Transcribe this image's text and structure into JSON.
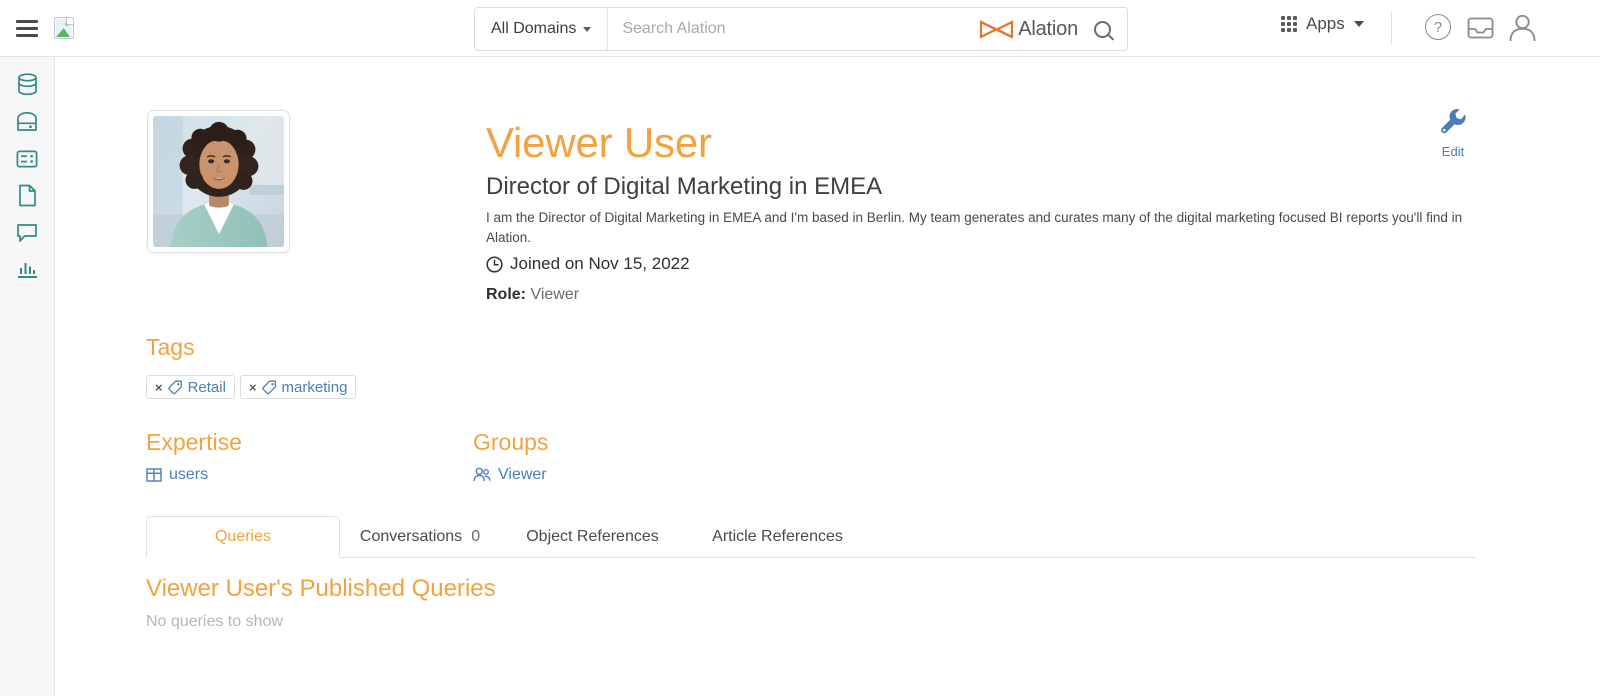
{
  "topbar": {
    "menu_icon": "hamburger-menu-icon",
    "logo_icon": "broken-image-icon",
    "domain_selector": "All Domains",
    "search_placeholder": "Search Alation",
    "brand_name": "Alation",
    "search_icon": "search-icon",
    "apps_label": "Apps",
    "apps_icon": "grid-apps-icon",
    "help_icon_char": "?",
    "help_icon": "help-circle-icon",
    "inbox_icon": "inbox-tray-icon",
    "account_icon": "user-account-icon"
  },
  "sidebar": {
    "items": [
      {
        "name": "sidebar-item-data-sources",
        "icon": "database-icon"
      },
      {
        "name": "sidebar-item-catalog",
        "icon": "vault-icon"
      },
      {
        "name": "sidebar-item-queries",
        "icon": "card-list-icon"
      },
      {
        "name": "sidebar-item-documents",
        "icon": "document-icon"
      },
      {
        "name": "sidebar-item-conversations",
        "icon": "chat-bubble-icon"
      },
      {
        "name": "sidebar-item-analytics",
        "icon": "bar-chart-icon"
      }
    ]
  },
  "profile": {
    "avatar_alt": "profile-photo-of-woman-in-teal-blazer",
    "name": "Viewer User",
    "title": "Director of Digital Marketing in EMEA",
    "bio": "I am the Director of Digital Marketing in EMEA and I'm based in Berlin. My team generates and curates many of the digital marketing focused BI reports you'll find in Alation.",
    "joined_icon": "clock-icon",
    "joined": "Joined on Nov 15, 2022",
    "role_label": "Role:",
    "role_value": "Viewer",
    "edit_label": "Edit",
    "edit_icon": "wrench-icon"
  },
  "tags": {
    "heading": "Tags",
    "items": [
      {
        "label": "Retail",
        "remove": "×",
        "icon": "tag-icon"
      },
      {
        "label": "marketing",
        "remove": "×",
        "icon": "tag-icon"
      }
    ]
  },
  "expertise": {
    "heading": "Expertise",
    "items": [
      {
        "label": "users",
        "icon": "table-icon"
      }
    ]
  },
  "groups": {
    "heading": "Groups",
    "items": [
      {
        "label": "Viewer",
        "icon": "people-group-icon"
      }
    ]
  },
  "tabs": [
    {
      "label": "Queries",
      "count": "",
      "active": true
    },
    {
      "label": "Conversations",
      "count": "0",
      "active": false
    },
    {
      "label": "Object References",
      "count": "",
      "active": false
    },
    {
      "label": "Article References",
      "count": "",
      "active": false
    }
  ],
  "panel": {
    "heading": "Viewer User's Published Queries",
    "empty": "No queries to show"
  },
  "colors": {
    "accent_orange": "#f2a33f",
    "link_blue": "#4a7ebb",
    "sidebar_teal": "#2e8b85",
    "brand_orange": "#e8722a"
  }
}
